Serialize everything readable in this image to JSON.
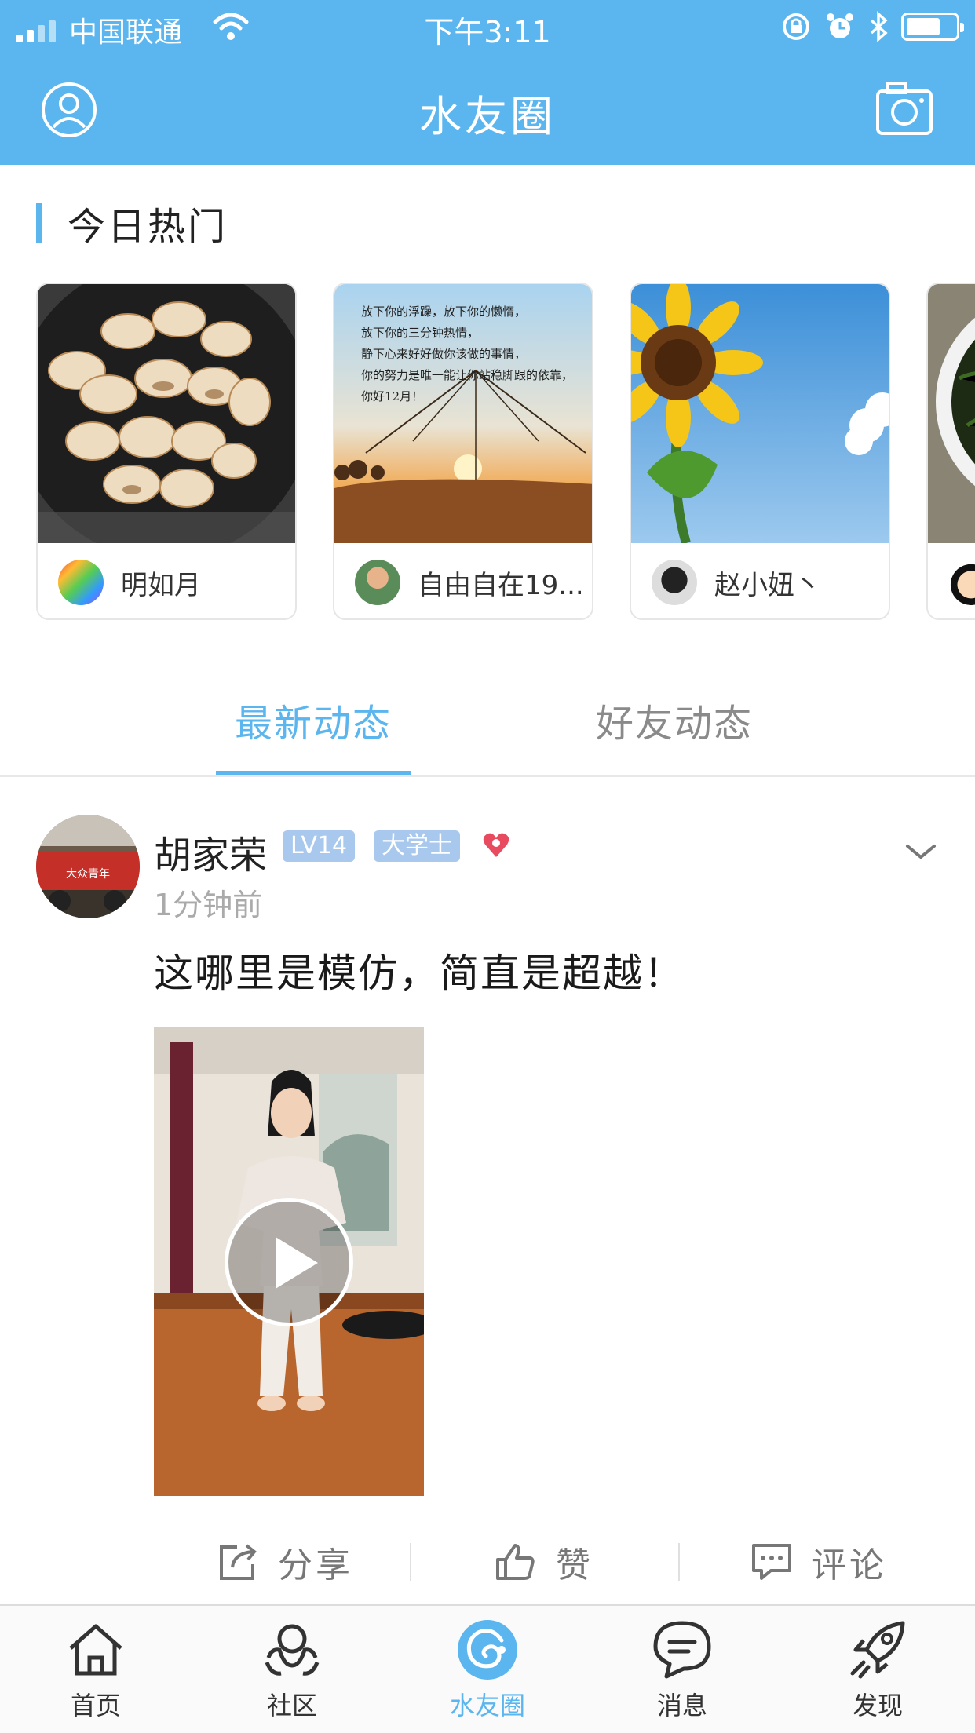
{
  "status_bar": {
    "carrier": "中国联通",
    "time": "下午3:11"
  },
  "nav": {
    "title": "水友圈",
    "left_icon": "profile-icon",
    "right_icon": "camera-icon"
  },
  "hot": {
    "title": "今日热门",
    "cards": [
      {
        "user": "明如月"
      },
      {
        "user": "自由自在19..."
      },
      {
        "user": "赵小妞丶"
      },
      {
        "user": ""
      }
    ],
    "quote_lines": [
      "放下你的浮躁，放下你的懒惰，",
      "放下你的三分钟热情，",
      "静下心来好好做你该做的事情，",
      "你的努力是唯一能让你站稳脚跟的依靠，",
      "你好12月！"
    ]
  },
  "tabs": [
    {
      "label": "最新动态",
      "active": true
    },
    {
      "label": "好友动态",
      "active": false
    }
  ],
  "post": {
    "author": "胡家荣",
    "level": "LV14",
    "title_badge": "大学士",
    "time": "1分钟前",
    "text": "这哪里是模仿，简直是超越！",
    "avatar_text": "大众青年",
    "actions": {
      "share": "分享",
      "like": "赞",
      "comment": "评论"
    }
  },
  "tabbar": [
    {
      "label": "首页",
      "icon": "home-icon"
    },
    {
      "label": "社区",
      "icon": "community-icon"
    },
    {
      "label": "水友圈",
      "icon": "water-circle-icon",
      "active": true
    },
    {
      "label": "消息",
      "icon": "message-icon"
    },
    {
      "label": "发现",
      "icon": "rocket-icon"
    }
  ],
  "colors": {
    "brand": "#5bb5ee",
    "badge": "#a9c8ee",
    "heart": "#e84a5f"
  }
}
